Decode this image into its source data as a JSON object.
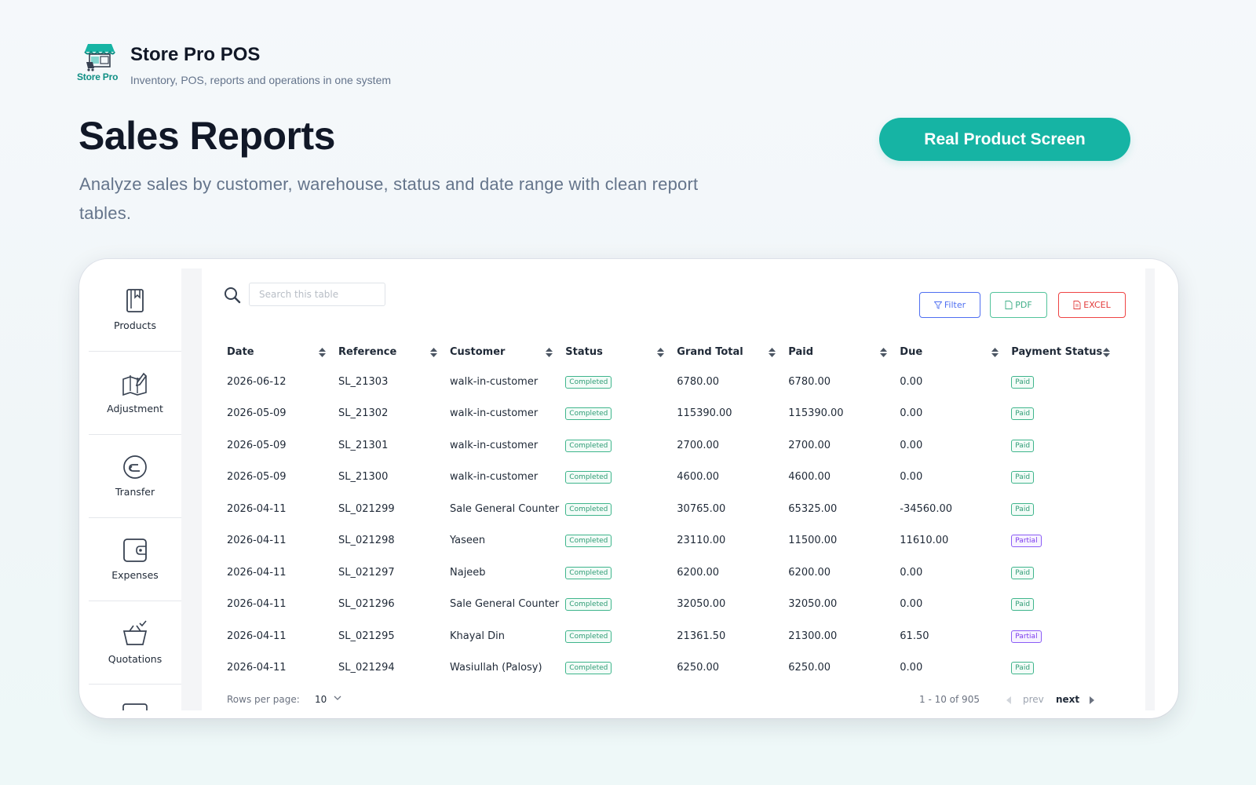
{
  "brand": {
    "logo_text": "Store Pro",
    "title": "Store Pro POS",
    "subtitle": "Inventory, POS, reports and operations in one system"
  },
  "hero": {
    "title": "Sales Reports",
    "description": "Analyze sales by customer, warehouse, status and date range with clean report tables.",
    "cta_label": "Real Product Screen"
  },
  "sidebar": {
    "items": [
      {
        "label": "Products",
        "icon": "book-icon"
      },
      {
        "label": "Adjustment",
        "icon": "map-edit-icon"
      },
      {
        "label": "Transfer",
        "icon": "return-arrow-icon"
      },
      {
        "label": "Expenses",
        "icon": "wallet-icon"
      },
      {
        "label": "Quotations",
        "icon": "basket-check-icon"
      }
    ]
  },
  "toolbar": {
    "search_placeholder": "Search this table",
    "filter_label": "Filter",
    "pdf_label": "PDF",
    "excel_label": "EXCEL"
  },
  "table": {
    "columns": [
      "Date",
      "Reference",
      "Customer",
      "Status",
      "Grand Total",
      "Paid",
      "Due",
      "Payment Status"
    ],
    "rows": [
      {
        "date": "2026-06-12",
        "ref": "SL_21303",
        "customer": "walk-in-customer",
        "status": "Completed",
        "total": "6780.00",
        "paid": "6780.00",
        "due": "0.00",
        "pay": "Paid"
      },
      {
        "date": "2026-05-09",
        "ref": "SL_21302",
        "customer": "walk-in-customer",
        "status": "Completed",
        "total": "115390.00",
        "paid": "115390.00",
        "due": "0.00",
        "pay": "Paid"
      },
      {
        "date": "2026-05-09",
        "ref": "SL_21301",
        "customer": "walk-in-customer",
        "status": "Completed",
        "total": "2700.00",
        "paid": "2700.00",
        "due": "0.00",
        "pay": "Paid"
      },
      {
        "date": "2026-05-09",
        "ref": "SL_21300",
        "customer": "walk-in-customer",
        "status": "Completed",
        "total": "4600.00",
        "paid": "4600.00",
        "due": "0.00",
        "pay": "Paid"
      },
      {
        "date": "2026-04-11",
        "ref": "SL_021299",
        "customer": "Sale General Counter",
        "status": "Completed",
        "total": "30765.00",
        "paid": "65325.00",
        "due": "-34560.00",
        "pay": "Paid"
      },
      {
        "date": "2026-04-11",
        "ref": "SL_021298",
        "customer": "Yaseen",
        "status": "Completed",
        "total": "23110.00",
        "paid": "11500.00",
        "due": "11610.00",
        "pay": "Partial"
      },
      {
        "date": "2026-04-11",
        "ref": "SL_021297",
        "customer": "Najeeb",
        "status": "Completed",
        "total": "6200.00",
        "paid": "6200.00",
        "due": "0.00",
        "pay": "Paid"
      },
      {
        "date": "2026-04-11",
        "ref": "SL_021296",
        "customer": "Sale General Counter",
        "status": "Completed",
        "total": "32050.00",
        "paid": "32050.00",
        "due": "0.00",
        "pay": "Paid"
      },
      {
        "date": "2026-04-11",
        "ref": "SL_021295",
        "customer": "Khayal Din",
        "status": "Completed",
        "total": "21361.50",
        "paid": "21300.00",
        "due": "61.50",
        "pay": "Partial"
      },
      {
        "date": "2026-04-11",
        "ref": "SL_021294",
        "customer": "Wasiullah (Palosy)",
        "status": "Completed",
        "total": "6250.00",
        "paid": "6250.00",
        "due": "0.00",
        "pay": "Paid"
      }
    ]
  },
  "pagination": {
    "rows_per_page_label": "Rows per page:",
    "rows_per_page_value": "10",
    "range": "1 - 10 of 905",
    "prev_label": "prev",
    "next_label": "next"
  },
  "colors": {
    "accent": "#16b4a4",
    "paid": "#2f9c75",
    "partial": "#7c3aed",
    "filter": "#4f6ff1",
    "excel": "#e23b3b"
  }
}
